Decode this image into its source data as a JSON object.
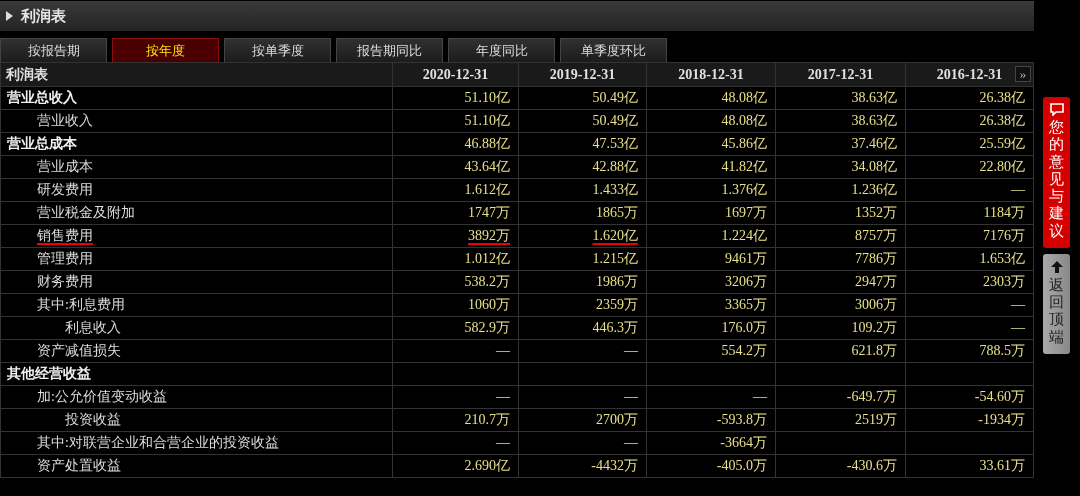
{
  "panel": {
    "title": "利润表"
  },
  "tabs": [
    {
      "label": "按报告期",
      "selected": false
    },
    {
      "label": "按年度",
      "selected": true
    },
    {
      "label": "按单季度",
      "selected": false
    },
    {
      "label": "报告期同比",
      "selected": false
    },
    {
      "label": "年度同比",
      "selected": false
    },
    {
      "label": "单季度环比",
      "selected": false
    }
  ],
  "table": {
    "columns": [
      "利润表",
      "2020-12-31",
      "2019-12-31",
      "2018-12-31",
      "2017-12-31",
      "2016-12-31"
    ],
    "more_button": "»",
    "rows": [
      {
        "label": "营业总收入",
        "values": [
          "51.10亿",
          "50.49亿",
          "48.08亿",
          "38.63亿",
          "26.38亿"
        ],
        "children": [
          {
            "label": "营业收入",
            "values": [
              "51.10亿",
              "50.49亿",
              "48.08亿",
              "38.63亿",
              "26.38亿"
            ]
          }
        ]
      },
      {
        "label": "营业总成本",
        "values": [
          "46.88亿",
          "47.53亿",
          "45.86亿",
          "37.46亿",
          "25.59亿"
        ],
        "children": [
          {
            "label": "营业成本",
            "values": [
              "43.64亿",
              "42.88亿",
              "41.82亿",
              "34.08亿",
              "22.80亿"
            ]
          },
          {
            "label": "研发费用",
            "values": [
              "1.612亿",
              "1.433亿",
              "1.376亿",
              "1.236亿",
              "—"
            ]
          },
          {
            "label": "营业税金及附加",
            "values": [
              "1747万",
              "1865万",
              "1697万",
              "1352万",
              "1184万"
            ]
          },
          {
            "label": "销售费用",
            "underlined": true,
            "values": [
              "3892万",
              "1.620亿",
              "1.224亿",
              "8757万",
              "7176万"
            ],
            "underlined_values": [
              true,
              true,
              false,
              false,
              false
            ]
          },
          {
            "label": "管理费用",
            "values": [
              "1.012亿",
              "1.215亿",
              "9461万",
              "7786万",
              "1.653亿"
            ]
          },
          {
            "label": "财务费用",
            "values": [
              "538.2万",
              "1986万",
              "3206万",
              "2947万",
              "2303万"
            ]
          },
          {
            "label": "其中:利息费用",
            "values": [
              "1060万",
              "2359万",
              "3365万",
              "3006万",
              "—"
            ],
            "children": [
              {
                "label": "利息收入",
                "values": [
                  "582.9万",
                  "446.3万",
                  "176.0万",
                  "109.2万",
                  "—"
                ]
              }
            ]
          },
          {
            "label": "资产减值损失",
            "values": [
              "—",
              "—",
              "554.2万",
              "621.8万",
              "788.5万"
            ]
          }
        ]
      },
      {
        "label": "其他经营收益",
        "children": [
          {
            "label": "加:公允价值变动收益",
            "values": [
              "—",
              "—",
              "—",
              "-649.7万",
              "-54.60万"
            ],
            "children": [
              {
                "label": "投资收益",
                "values": [
                  "210.7万",
                  "2700万",
                  "-593.8万",
                  "2519万",
                  "-1934万"
                ]
              }
            ]
          },
          {
            "label": "其中:对联营企业和合营企业的投资收益",
            "values": [
              "—",
              "—",
              "-3664万"
            ]
          },
          {
            "label": "资产处置收益",
            "values": [
              "2.690亿",
              "-4432万",
              "-405.0万",
              "-430.6万",
              "33.61万"
            ]
          }
        ]
      }
    ]
  },
  "side_buttons": [
    {
      "kind": "feedback",
      "label": "您的意见与建议"
    },
    {
      "kind": "top",
      "label": "返回顶端"
    }
  ]
}
